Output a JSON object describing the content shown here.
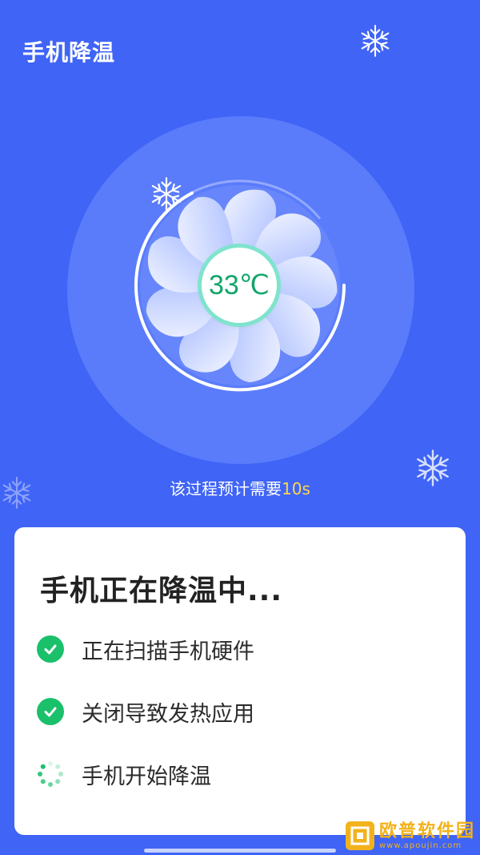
{
  "header": {
    "title": "手机降温"
  },
  "fan": {
    "temperature": "33℃"
  },
  "estimate": {
    "prefix": "该过程预计需要",
    "time": "10s"
  },
  "card": {
    "title": "手机正在降温中...",
    "steps": [
      {
        "label": "正在扫描手机硬件",
        "status": "done"
      },
      {
        "label": "关闭导致发热应用",
        "status": "done"
      },
      {
        "label": "手机开始降温",
        "status": "in-progress"
      }
    ]
  },
  "watermark": {
    "name": "欧普软件园",
    "url": "www.apoujin.com"
  },
  "colors": {
    "background": "#3f64f6",
    "accent_green": "#1bc06b",
    "temp_text": "#12a66a",
    "time_highlight": "#ffd84a"
  },
  "icons": [
    "snowflake-icon",
    "check-circle-icon",
    "loading-spinner-icon"
  ]
}
